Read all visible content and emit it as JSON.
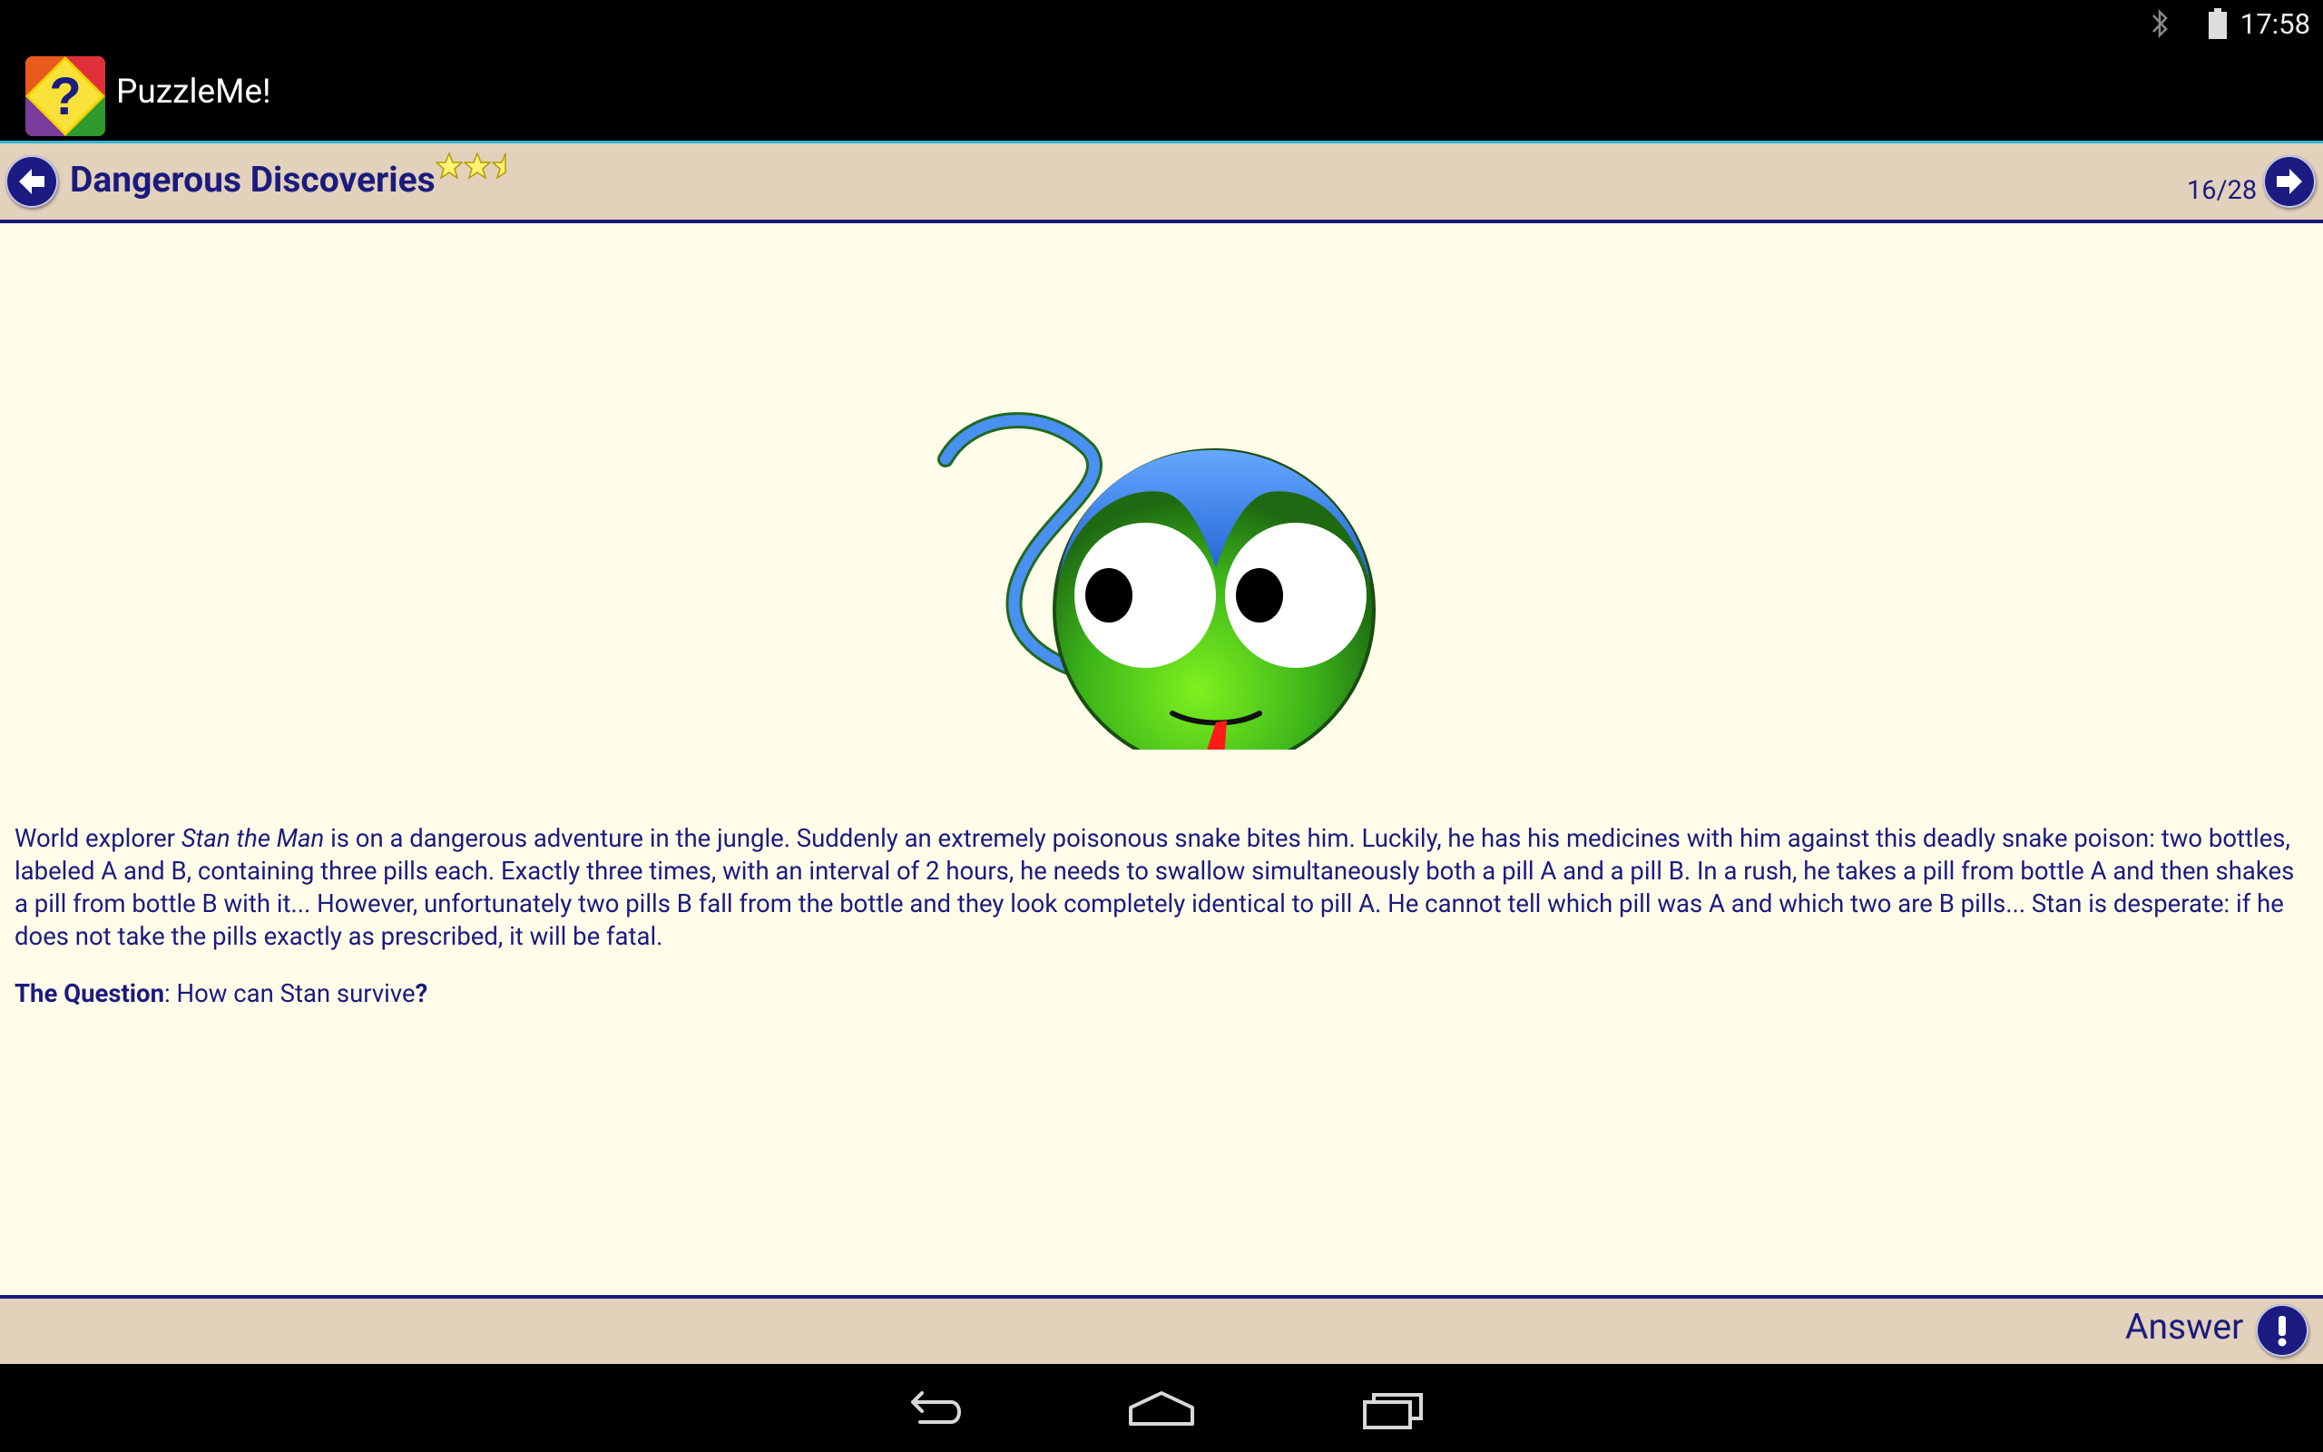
{
  "status_bar": {
    "time": "17:58"
  },
  "app": {
    "title": "PuzzleMe!"
  },
  "header": {
    "puzzle_title": "Dangerous Discoveries",
    "counter": "16/28",
    "rating": 2.5
  },
  "puzzle": {
    "text_parts": {
      "p1": "World explorer ",
      "name": "Stan the Man",
      "p2": " is on a dangerous adventure in the jungle. Suddenly an extremely poisonous snake bites him. Luckily, he has his medicines with him against this deadly snake poison: two bottles, labeled A and B, containing three pills each. Exactly three times, with an interval of 2 hours, he needs to swallow simultaneously both a pill A and a pill B. In a rush, he takes a pill from bottle A and then shakes a pill from bottle B with it... However, unfortunately two pills B fall from the bottle and they look completely identical to pill A. He cannot tell which pill was A and which two are B pills... Stan is desperate: if he does not take the pills exactly as prescribed, it will be fatal."
    },
    "question_label": "The Question",
    "question_sep": ": ",
    "question_text": "How can Stan survive",
    "question_mark": "?"
  },
  "footer": {
    "answer_label": "Answer"
  },
  "colors": {
    "header_bg": "#e2d1bb",
    "content_bg": "#fffde9",
    "text": "#1b1b7e",
    "accent_line": "#2fb5d8"
  }
}
